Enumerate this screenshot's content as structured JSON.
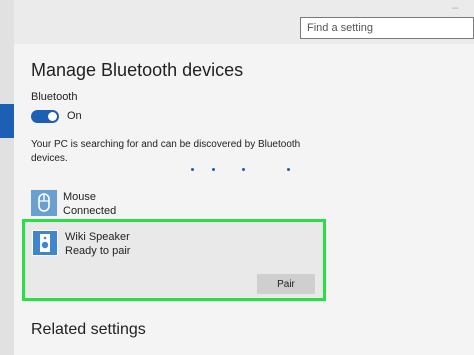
{
  "search": {
    "placeholder": "Find a setting"
  },
  "page": {
    "title": "Manage Bluetooth devices"
  },
  "bluetooth": {
    "label": "Bluetooth",
    "toggle_state": "On",
    "description": "Your PC is searching for and can be discovered by Bluetooth devices."
  },
  "devices": [
    {
      "name": "Mouse",
      "status": "Connected",
      "icon": "mouse-icon"
    },
    {
      "name": "Wiki Speaker",
      "status": "Ready to pair",
      "icon": "speaker-icon",
      "action_label": "Pair"
    }
  ],
  "related": {
    "heading": "Related settings"
  },
  "colors": {
    "accent": "#1d5fb4",
    "highlight": "#28e046",
    "icon_blue": "#6a9fd2"
  }
}
